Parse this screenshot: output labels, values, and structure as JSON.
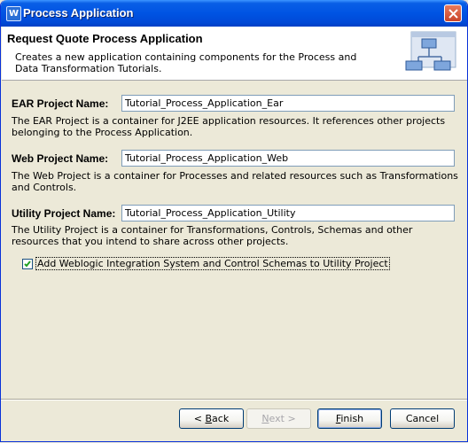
{
  "window": {
    "title": "Process Application"
  },
  "header": {
    "title": "Request Quote Process Application",
    "description": "Creates a new application containing components for the Process and Data Transformation Tutorials."
  },
  "fields": {
    "ear": {
      "label": "EAR Project Name:",
      "value": "Tutorial_Process_Application_Ear",
      "description": "The EAR Project is a container for J2EE application resources.  It references other projects belonging to the Process Application."
    },
    "web": {
      "label": "Web Project Name:",
      "value": "Tutorial_Process_Application_Web",
      "description": "The Web Project is a container for Processes and related resources such as Transformations and Controls."
    },
    "utility": {
      "label": "Utility Project Name:",
      "value": "Tutorial_Process_Application_Utility",
      "description": "The Utility Project is a container for Transformations, Controls, Schemas and other resources that you intend to share across other projects."
    }
  },
  "checkbox": {
    "label": "Add Weblogic Integration System and Control Schemas to Utility Project",
    "checked": true
  },
  "buttons": {
    "back_prefix": "< ",
    "back_mnemonic": "B",
    "back_rest": "ack",
    "next_prefix": "",
    "next_mnemonic": "N",
    "next_rest": "ext >",
    "finish_mnemonic": "F",
    "finish_rest": "inish",
    "cancel": "Cancel"
  },
  "colors": {
    "titlebar": "#0054e3",
    "dialog_bg": "#ece9d8",
    "field_border": "#7f9db9"
  },
  "icons": {
    "app": "weblogic-icon",
    "close": "close-icon",
    "wizard": "process-diagram-icon",
    "check": "checkmark-icon"
  }
}
